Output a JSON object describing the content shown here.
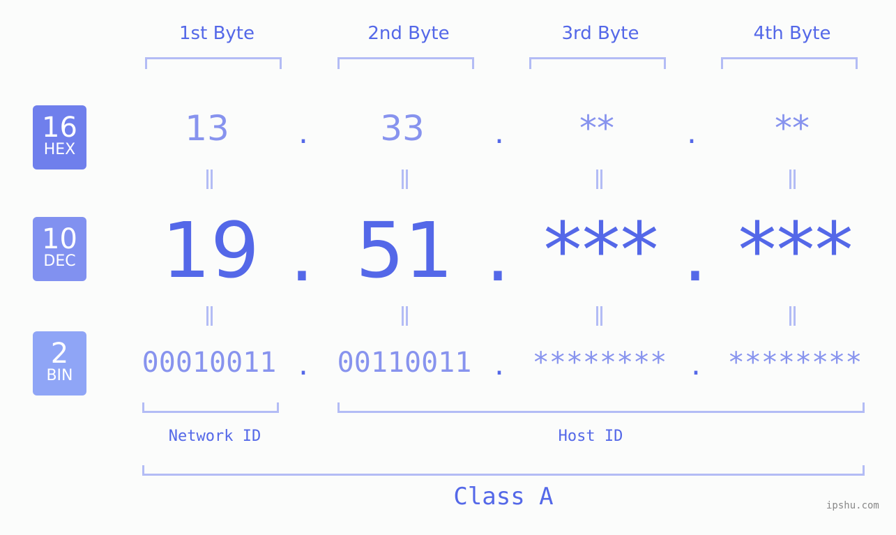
{
  "badges": [
    {
      "num": "16",
      "label": "HEX",
      "color": "#6f7fec"
    },
    {
      "num": "10",
      "label": "DEC",
      "color": "#8191f0"
    },
    {
      "num": "2",
      "label": "BIN",
      "color": "#8fa5f6"
    }
  ],
  "headers": [
    "1st Byte",
    "2nd Byte",
    "3rd Byte",
    "4th Byte"
  ],
  "hex": [
    "13",
    "33",
    "**",
    "**"
  ],
  "dec": [
    "19",
    "51",
    "***",
    "***"
  ],
  "bin": [
    "00010011",
    "00110011",
    "********",
    "********"
  ],
  "separator": ".",
  "equals": "=",
  "network_label": "Network ID",
  "host_label": "Host ID",
  "class_label": "Class A",
  "watermark": "ipshu.com",
  "colors": {
    "primary": "#5468e8",
    "light": "#8793ee",
    "bracket": "#b3bcf5"
  }
}
